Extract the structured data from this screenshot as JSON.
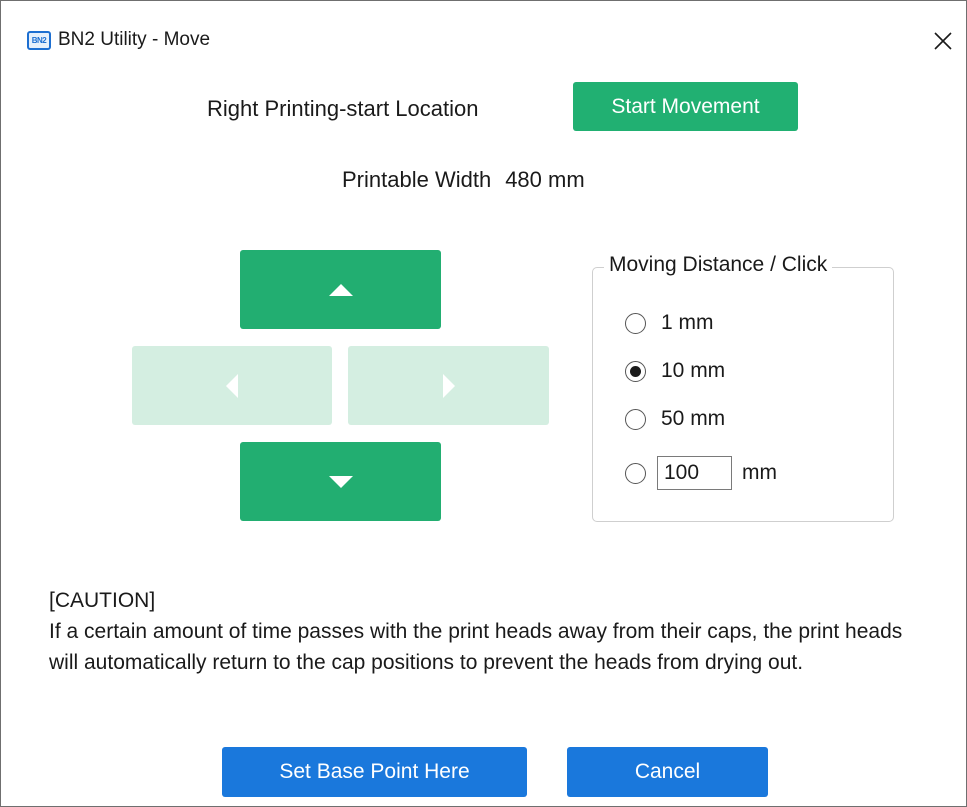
{
  "window": {
    "title": "BN2 Utility - Move",
    "app_icon_text": "BN2"
  },
  "header": {
    "location_label": "Right Printing-start Location",
    "start_button_label": "Start Movement",
    "printable_width_label": "Printable Width",
    "printable_width_value": "480 mm"
  },
  "direction_pad": {
    "up": {
      "icon": "triangle-up-icon",
      "enabled": true
    },
    "down": {
      "icon": "triangle-down-icon",
      "enabled": true
    },
    "left": {
      "icon": "triangle-left-icon",
      "enabled": false
    },
    "right": {
      "icon": "triangle-right-icon",
      "enabled": false
    },
    "active_color": "#22ae71",
    "disabled_color": "#d4eee1"
  },
  "moving_distance": {
    "title": "Moving Distance / Click",
    "options": [
      {
        "label": "1 mm",
        "checked": false
      },
      {
        "label": "10 mm",
        "checked": true
      },
      {
        "label": "50 mm",
        "checked": false
      }
    ],
    "custom": {
      "value": "100",
      "unit": "mm",
      "checked": false
    }
  },
  "caution": {
    "heading": "[CAUTION]",
    "body": "If a certain amount of time passes with the print heads away from their caps, the print heads will automatically return to the cap positions to prevent the heads from drying out."
  },
  "footer": {
    "set_base_label": "Set Base Point Here",
    "cancel_label": "Cancel"
  },
  "colors": {
    "green": "#21b072",
    "blue": "#1a78dc"
  }
}
